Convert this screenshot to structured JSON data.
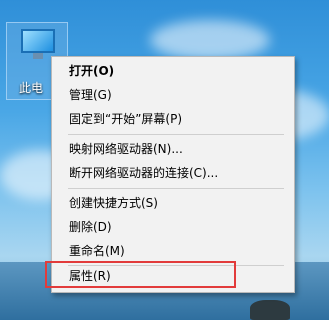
{
  "desktop": {
    "icon_label": "此电"
  },
  "menu": {
    "items": [
      {
        "label": "打开(O)"
      },
      {
        "label": "管理(G)"
      },
      {
        "label": "固定到“开始”屏幕(P)"
      },
      {
        "label": "映射网络驱动器(N)..."
      },
      {
        "label": "断开网络驱动器的连接(C)..."
      },
      {
        "label": "创建快捷方式(S)"
      },
      {
        "label": "删除(D)"
      },
      {
        "label": "重命名(M)"
      },
      {
        "label": "属性(R)"
      }
    ]
  },
  "colors": {
    "menu_bg": "#f2f2f2",
    "highlight_border": "#e23b3b"
  }
}
